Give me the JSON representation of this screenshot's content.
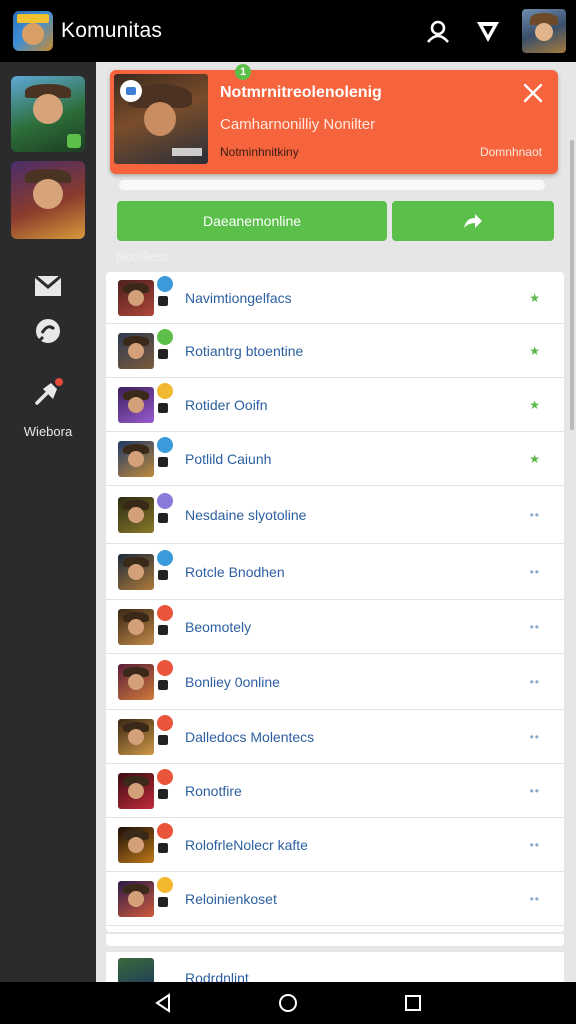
{
  "header": {
    "title": "Komunitas",
    "icons": [
      "profile-icon",
      "shield-icon"
    ]
  },
  "sidebar": {
    "label": "Wiebora",
    "icons": [
      "message-icon",
      "chat-bubble-icon",
      "pin-icon"
    ]
  },
  "hero": {
    "title": "Notmrnitreolenolenig",
    "subtitle": "Camharnonilliy Nonilter",
    "meta": "Notminhnitkiny",
    "action": "Domnhnaot",
    "badge": "1"
  },
  "progress": {
    "value": 1.0
  },
  "actions": {
    "primary_label": "Daeanemonline",
    "share_icon": "share-arrow-icon"
  },
  "list_section": {
    "label": "Notiffiess"
  },
  "rows": [
    {
      "name": "Navimtiongelfacs",
      "trail": "★",
      "kind": "star",
      "thumb": [
        "#4b1e1e",
        "#b0473a"
      ],
      "badge": "#3b9ad9"
    },
    {
      "name": "Rotiantrg btoentine",
      "trail": "★",
      "kind": "star",
      "thumb": [
        "#2e3a52",
        "#7a5b3a"
      ],
      "badge": "#5bbf4a"
    },
    {
      "name": "Rotider Ooifn",
      "trail": "★",
      "kind": "star",
      "thumb": [
        "#3a1f5a",
        "#9a5bd0"
      ],
      "badge": "#f2b830"
    },
    {
      "name": "Potlild Caiunh",
      "trail": "★",
      "kind": "star",
      "thumb": [
        "#1e3a6a",
        "#c08a3a"
      ],
      "badge": "#3b9ad9"
    },
    {
      "name": "Nesdaine slyotoline",
      "trail": "••",
      "kind": "more",
      "thumb": [
        "#2a2a12",
        "#8a7a2a"
      ],
      "badge": "#8a7ad9"
    },
    {
      "name": "Rotcle Bnodhen",
      "trail": "••",
      "kind": "more",
      "thumb": [
        "#1a2a3a",
        "#b07a3a"
      ],
      "badge": "#3b9ad9"
    },
    {
      "name": "Beomotely",
      "trail": "••",
      "kind": "more",
      "thumb": [
        "#3a2612",
        "#c08a4a"
      ],
      "badge": "#e8553a"
    },
    {
      "name": "Bonliey 0online",
      "trail": "••",
      "kind": "more",
      "thumb": [
        "#5a1e3a",
        "#d07a3a"
      ],
      "badge": "#e8553a"
    },
    {
      "name": "Dalledocs Molentecs",
      "trail": "••",
      "kind": "more",
      "thumb": [
        "#3a2612",
        "#d09a4a"
      ],
      "badge": "#e8553a"
    },
    {
      "name": "Ronotfire",
      "trail": "••",
      "kind": "more",
      "thumb": [
        "#3a0e12",
        "#c02a3a"
      ],
      "badge": "#e8553a"
    },
    {
      "name": "RolofrleNolecr kafte",
      "trail": "••",
      "kind": "more",
      "thumb": [
        "#1a0e08",
        "#c07a1a"
      ],
      "badge": "#e8553a"
    },
    {
      "name": "Reloinienkoset",
      "trail": "••",
      "kind": "more",
      "thumb": [
        "#2a1a4a",
        "#d05a3a"
      ],
      "badge": "#f2b830"
    }
  ],
  "peek_row": {
    "name": "Rodrdnlint"
  },
  "navbar": {
    "icons": [
      "back-icon",
      "home-icon",
      "recents-icon"
    ]
  },
  "colors": {
    "accent": "#f5643c",
    "primary_button": "#5ac04a",
    "sidebar": "#2b2b2e",
    "list_text": "#2c5fa0"
  }
}
